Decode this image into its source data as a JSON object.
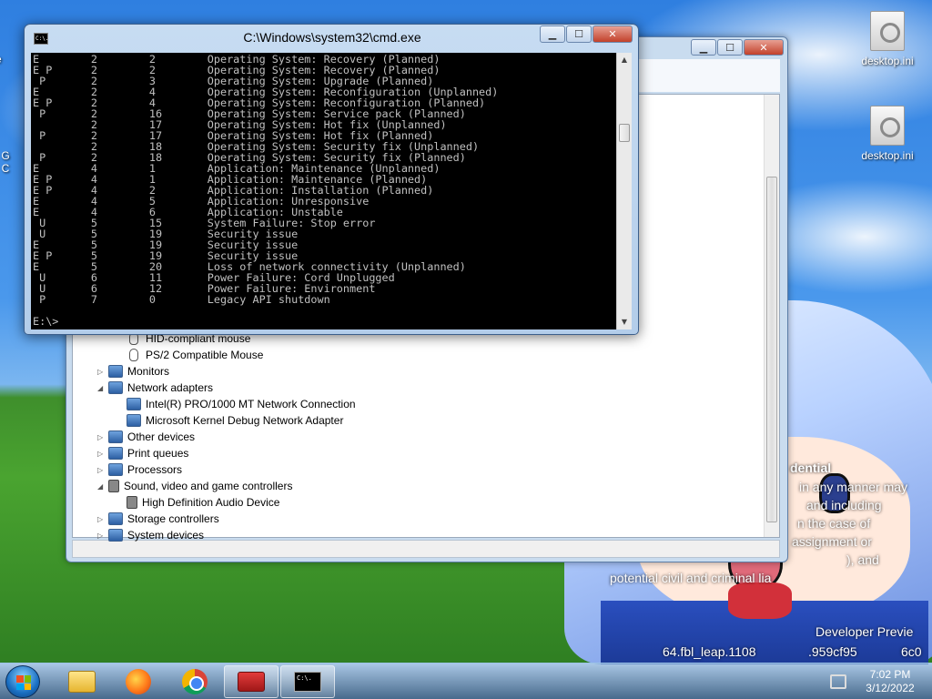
{
  "desktop": {
    "icons": [
      {
        "label": "desktop.ini"
      },
      {
        "label": "desktop.ini"
      }
    ],
    "recycle_partial": "Re",
    "left_partial": "G",
    "left_partial2": "C",
    "wallpaper_text": [
      "dential",
      "in any manner may",
      "and including",
      "n the case of",
      "assignment or",
      "), and",
      "potential civil and criminal lia",
      "Developer Previe",
      "64.fbl_leap.1108",
      ".959cf95",
      "6c0"
    ]
  },
  "device_manager": {
    "tree": [
      {
        "label": "HID-compliant mouse",
        "level": 1,
        "icon": "mouse-icon"
      },
      {
        "label": "PS/2 Compatible Mouse",
        "level": 1,
        "icon": "mouse-icon"
      },
      {
        "label": "Monitors",
        "level": 0,
        "expander": "▷",
        "icon": "monitor-icon"
      },
      {
        "label": "Network adapters",
        "level": 0,
        "expander": "◢",
        "icon": "network-adapter-icon"
      },
      {
        "label": "Intel(R) PRO/1000 MT Network Connection",
        "level": 1,
        "icon": "network-adapter-icon"
      },
      {
        "label": "Microsoft Kernel Debug Network Adapter",
        "level": 1,
        "icon": "network-adapter-icon"
      },
      {
        "label": "Other devices",
        "level": 0,
        "expander": "▷",
        "icon": "unknown-device-icon"
      },
      {
        "label": "Print queues",
        "level": 0,
        "expander": "▷",
        "icon": "printer-icon"
      },
      {
        "label": "Processors",
        "level": 0,
        "expander": "▷",
        "icon": "processor-icon"
      },
      {
        "label": "Sound, video and game controllers",
        "level": 0,
        "expander": "◢",
        "icon": "speaker-icon"
      },
      {
        "label": "High Definition Audio Device",
        "level": 1,
        "icon": "speaker-icon"
      },
      {
        "label": "Storage controllers",
        "level": 0,
        "expander": "▷",
        "icon": "storage-icon"
      },
      {
        "label": "System devices",
        "level": 0,
        "expander": "▷",
        "icon": "system-icon"
      }
    ],
    "title_buttons": {
      "minimize": "▁",
      "maximize": "☐",
      "close": "✕"
    }
  },
  "cmd": {
    "title": "C:\\Windows\\system32\\cmd.exe",
    "icon_text": "C:\\.",
    "buttons": {
      "minimize": "▁",
      "maximize": "☐",
      "close": "✕"
    },
    "lines": [
      "E        2        2        Operating System: Recovery (Planned)",
      "E P      2        2        Operating System: Recovery (Planned)",
      " P       2        3        Operating System: Upgrade (Planned)",
      "E        2        4        Operating System: Reconfiguration (Unplanned)",
      "E P      2        4        Operating System: Reconfiguration (Planned)",
      " P       2        16       Operating System: Service pack (Planned)",
      "         2        17       Operating System: Hot fix (Unplanned)",
      " P       2        17       Operating System: Hot fix (Planned)",
      "         2        18       Operating System: Security fix (Unplanned)",
      " P       2        18       Operating System: Security fix (Planned)",
      "E        4        1        Application: Maintenance (Unplanned)",
      "E P      4        1        Application: Maintenance (Planned)",
      "E P      4        2        Application: Installation (Planned)",
      "E        4        5        Application: Unresponsive",
      "E        4        6        Application: Unstable",
      " U       5        15       System Failure: Stop error",
      " U       5        19       Security issue",
      "E        5        19       Security issue",
      "E P      5        19       Security issue",
      "E        5        20       Loss of network connectivity (Unplanned)",
      " U       6        11       Power Failure: Cord Unplugged",
      " U       6        12       Power Failure: Environment",
      " P       7        0        Legacy API shutdown",
      "",
      "E:\\>_"
    ]
  },
  "taskbar": {
    "items": [
      {
        "name": "file-explorer",
        "active": false
      },
      {
        "name": "firefox",
        "active": false
      },
      {
        "name": "chrome",
        "active": false
      },
      {
        "name": "toolbox",
        "active": true
      },
      {
        "name": "cmd",
        "active": true
      }
    ],
    "clock": {
      "time": "7:02 PM",
      "date": "3/12/2022"
    }
  }
}
